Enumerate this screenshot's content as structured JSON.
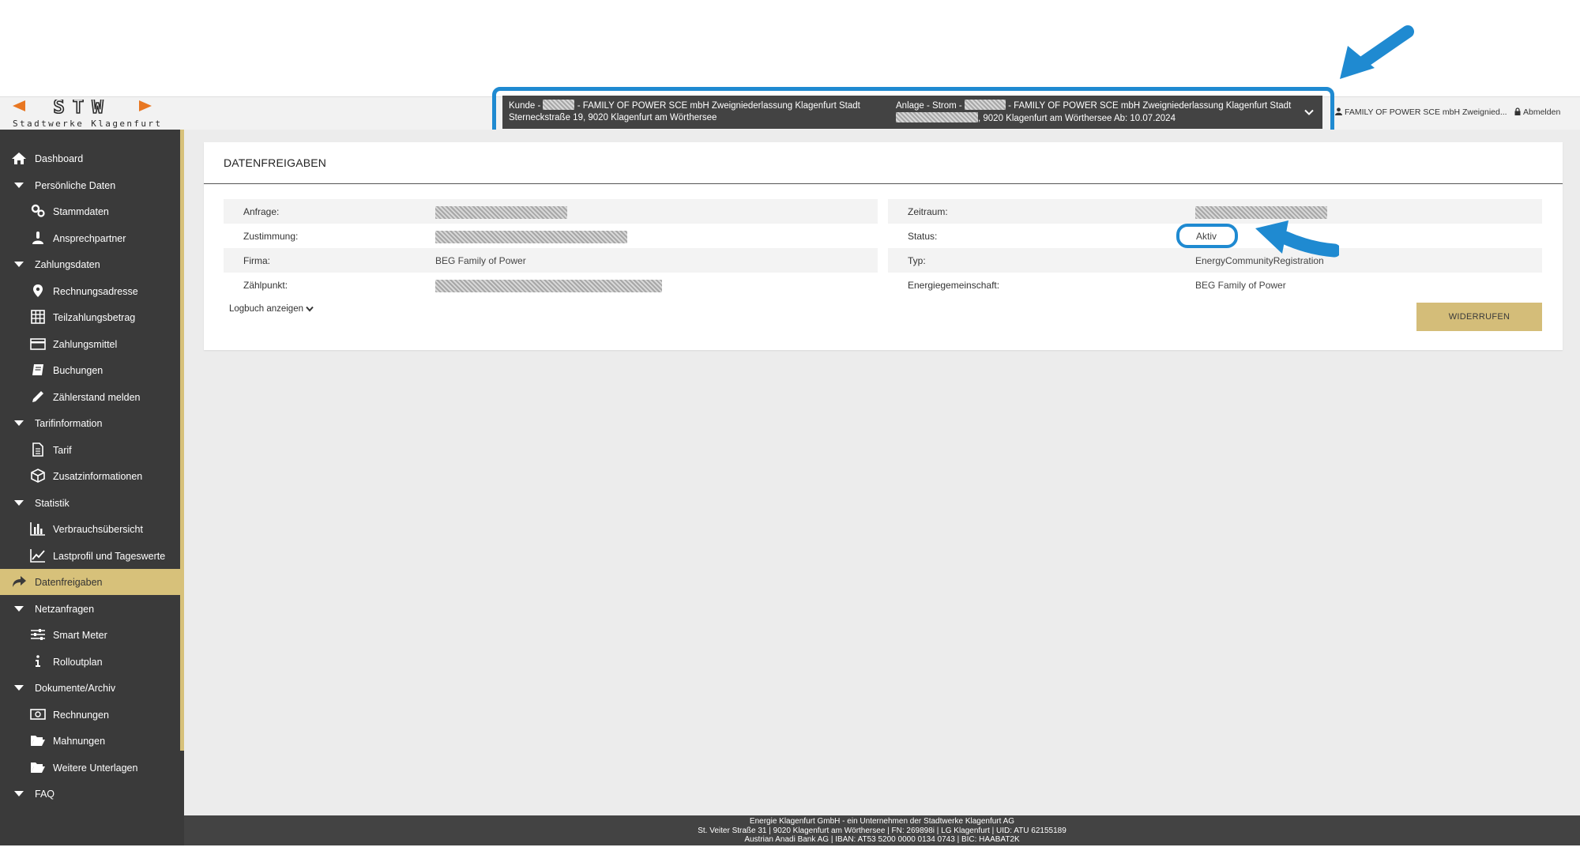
{
  "brand": {
    "logo_text": "STW",
    "tagline": "Stadtwerke Klagenfurt",
    "color": "#e87722"
  },
  "context": {
    "customer_prefix": "Kunde -",
    "customer_line1_rest": "- FAMILY OF POWER SCE mbH Zweigniederlassung Klagenfurt Stadt",
    "customer_line2": "Sterneckstraße 19, 9020 Klagenfurt am Wörthersee",
    "plant_prefix": "Anlage - Strom -",
    "plant_line1_rest": "- FAMILY OF POWER SCE mbH Zweigniederlassung Klagenfurt Stadt",
    "plant_line2_rest": ", 9020 Klagenfurt am Wörthersee Ab: 10.07.2024"
  },
  "header": {
    "user": "FAMILY OF POWER SCE mbH Zweignied...",
    "logout": "Abmelden"
  },
  "sidebar": {
    "items": [
      {
        "label": "Dashboard"
      },
      {
        "label": "Persönliche Daten"
      },
      {
        "label": "Stammdaten"
      },
      {
        "label": "Ansprechpartner"
      },
      {
        "label": "Zahlungsdaten"
      },
      {
        "label": "Rechnungsadresse"
      },
      {
        "label": "Teilzahlungsbetrag"
      },
      {
        "label": "Zahlungsmittel"
      },
      {
        "label": "Buchungen"
      },
      {
        "label": "Zählerstand melden"
      },
      {
        "label": "Tarifinformation"
      },
      {
        "label": "Tarif"
      },
      {
        "label": "Zusatzinformationen"
      },
      {
        "label": "Statistik"
      },
      {
        "label": "Verbrauchsübersicht"
      },
      {
        "label": "Lastprofil und Tageswerte"
      },
      {
        "label": "Datenfreigaben"
      },
      {
        "label": "Netzanfragen"
      },
      {
        "label": "Smart Meter"
      },
      {
        "label": "Rolloutplan"
      },
      {
        "label": "Dokumente/Archiv"
      },
      {
        "label": "Rechnungen"
      },
      {
        "label": "Mahnungen"
      },
      {
        "label": "Weitere Unterlagen"
      },
      {
        "label": "FAQ"
      }
    ]
  },
  "main": {
    "title": "DATENFREIGABEN",
    "fields": {
      "anfrage_label": "Anfrage:",
      "zustimmung_label": "Zustimmung:",
      "firma_label": "Firma:",
      "firma_value": "BEG Family of Power",
      "zaehlpunkt_label": "Zählpunkt:",
      "zeitraum_label": "Zeitraum:",
      "status_label": "Status:",
      "status_value": "Aktiv",
      "typ_label": "Typ:",
      "typ_value": "EnergyCommunityRegistration",
      "energiegemeinschaft_label": "Energiegemeinschaft:",
      "energiegemeinschaft_value": "BEG Family of Power"
    },
    "logbook_label": "Logbuch anzeigen",
    "revoke_label": "WIDERRUFEN"
  },
  "footer": {
    "line1": "Energie Klagenfurt GmbH - ein Unternehmen der Stadtwerke Klagenfurt AG",
    "line2": "St. Veiter Straße 31 | 9020 Klagenfurt am Wörthersee | FN: 269898i | LG Klagenfurt | UID: ATU 62155189",
    "line3": "Austrian Anadi Bank AG | IBAN: AT53 5200 0000 0134 0743 | BIC: HAABAT2K"
  },
  "colors": {
    "accent": "#d7c17a",
    "sidebar": "#3a3a3a",
    "highlight": "#1f8ad1",
    "button": "#d4bd79"
  }
}
